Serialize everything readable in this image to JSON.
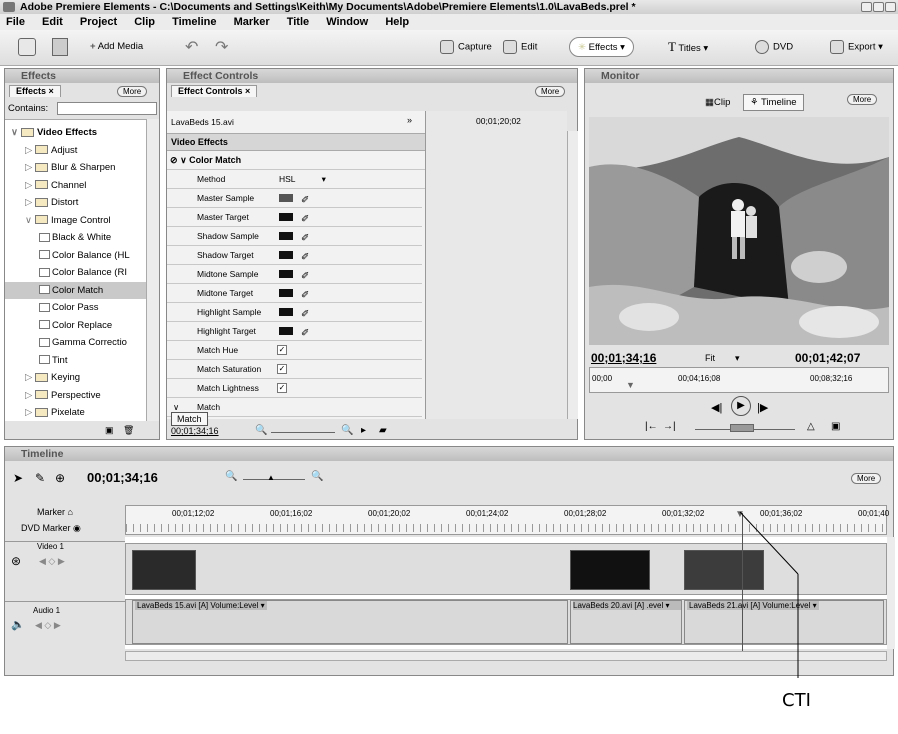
{
  "window": {
    "title": "Adobe Premiere Elements - C:\\Documents and Settings\\Keith\\My Documents\\Adobe\\Premiere Elements\\1.0\\LavaBeds.prel *"
  },
  "menu": [
    "File",
    "Edit",
    "Project",
    "Clip",
    "Timeline",
    "Marker",
    "Title",
    "Window",
    "Help"
  ],
  "toolbar": {
    "add_media": "Add Media",
    "capture": "Capture",
    "edit": "Edit",
    "effects": "Effects",
    "titles": "Titles",
    "dvd": "DVD",
    "export": "Export"
  },
  "effects_panel": {
    "title": "Effects",
    "tab": "Effects",
    "more": "More",
    "contains_label": "Contains:",
    "contains_value": "",
    "items": [
      {
        "label": "Video Effects",
        "level": 0,
        "open": true,
        "bold": true
      },
      {
        "label": "Adjust",
        "level": 1
      },
      {
        "label": "Blur & Sharpen",
        "level": 1
      },
      {
        "label": "Channel",
        "level": 1
      },
      {
        "label": "Distort",
        "level": 1
      },
      {
        "label": "Image Control",
        "level": 1,
        "open": true
      },
      {
        "label": "Black & White",
        "level": 2
      },
      {
        "label": "Color Balance (HL",
        "level": 2
      },
      {
        "label": "Color Balance (RI",
        "level": 2
      },
      {
        "label": "Color Match",
        "level": 2,
        "selected": true
      },
      {
        "label": "Color Pass",
        "level": 2
      },
      {
        "label": "Color Replace",
        "level": 2
      },
      {
        "label": "Gamma Correctio",
        "level": 2
      },
      {
        "label": "Tint",
        "level": 2
      },
      {
        "label": "Keying",
        "level": 1
      },
      {
        "label": "Perspective",
        "level": 1
      },
      {
        "label": "Pixelate",
        "level": 1
      }
    ]
  },
  "effect_controls": {
    "title": "Effect Controls",
    "tab": "Effect Controls",
    "more": "More",
    "clip_name": "LavaBeds 15.avi",
    "timecode_top": "00;01;20;02",
    "section": "Video Effects",
    "effect_name": "Color Match",
    "method_label": "Method",
    "method_value": "HSL",
    "rows": [
      {
        "label": "Master Sample",
        "kind": "swatch",
        "color": "#555555"
      },
      {
        "label": "Master Target",
        "kind": "swatch",
        "color": "#111111"
      },
      {
        "label": "Shadow Sample",
        "kind": "swatch",
        "color": "#111111"
      },
      {
        "label": "Shadow Target",
        "kind": "swatch",
        "color": "#111111"
      },
      {
        "label": "Midtone Sample",
        "kind": "swatch",
        "color": "#111111"
      },
      {
        "label": "Midtone Target",
        "kind": "swatch",
        "color": "#111111"
      },
      {
        "label": "Highlight Sample",
        "kind": "swatch",
        "color": "#111111"
      },
      {
        "label": "Highlight Target",
        "kind": "swatch",
        "color": "#111111"
      },
      {
        "label": "Match Hue",
        "kind": "check"
      },
      {
        "label": "Match Saturation",
        "kind": "check"
      },
      {
        "label": "Match Lightness",
        "kind": "check"
      },
      {
        "label": "Match",
        "kind": "plain"
      }
    ],
    "match_button": "Match",
    "bottom_timecode": "00;01;34;16"
  },
  "monitor": {
    "title": "Monitor",
    "more": "More",
    "clip_tab": "Clip",
    "timeline_tab": "Timeline",
    "current_time": "00;01;34;16",
    "fit": "Fit",
    "duration": "00;01;42;07",
    "ruler_start": "00;00",
    "ruler_mid": "00;04;16;08",
    "ruler_end": "00;08;32;16"
  },
  "timeline": {
    "title": "Timeline",
    "more": "More",
    "current_time": "00;01;34;16",
    "marker_label": "Marker",
    "dvd_marker_label": "DVD Marker",
    "ruler_labels": [
      "00;01;12;02",
      "00;01;16;02",
      "00;01;20;02",
      "00;01;24;02",
      "00;01;28;02",
      "00;01;32;02",
      "00;01;36;02",
      "00;01;40"
    ],
    "video_track": "Video 1",
    "audio_track": "Audio 1",
    "audio_clips": [
      {
        "label": "LavaBeds 15.avi [A]  Volume:Level ▾"
      },
      {
        "label": "LavaBeds 20.avi [A] .evel ▾"
      },
      {
        "label": "LavaBeds 21.avi [A] Volume:Level ▾"
      }
    ]
  },
  "callout": {
    "label": "CTI"
  }
}
